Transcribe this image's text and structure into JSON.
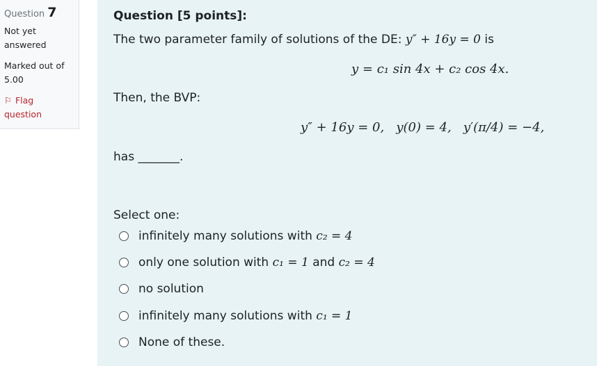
{
  "info": {
    "question_word": "Question",
    "question_number": "7",
    "state_line1": "Not yet",
    "state_line2": "answered",
    "grade_line1": "Marked out of",
    "grade_line2": "5.00",
    "flag_icon": "⚐",
    "flag_line1": "Flag",
    "flag_line2": "question"
  },
  "question": {
    "heading": "Question [5 points]:",
    "intro_prefix": "The two parameter family of solutions of the DE:",
    "intro_math": "y″ + 16y = 0",
    "intro_suffix": "is",
    "general_solution": "y = c₁ sin 4x + c₂ cos 4x.",
    "then_text": "Then, the BVP:",
    "bvp": "y″ + 16y = 0,   y(0) = 4,   y′(π/4) = −4,",
    "has_text": "has _______."
  },
  "select_label": "Select one:",
  "options": [
    {
      "text": "infinitely many solutions with",
      "math": "c₂ = 4"
    },
    {
      "text": "only one solution with",
      "math": "c₁ = 1",
      "text2": "and",
      "math2": "c₂ = 4"
    },
    {
      "text": "no solution"
    },
    {
      "text": "infinitely many solutions with",
      "math": "c₁ = 1"
    },
    {
      "text": "None of these."
    }
  ]
}
